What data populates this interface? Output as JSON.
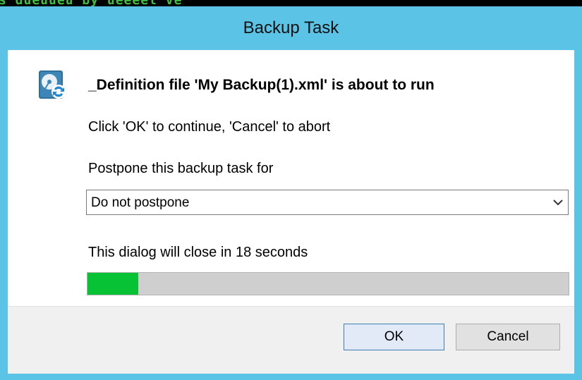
{
  "background_text": "s dueuueu by ueeeet ve",
  "window": {
    "title": "Backup Task"
  },
  "icon": "backup-drive-icon",
  "message": {
    "heading": "_Definition file 'My Backup(1).xml' is about to run",
    "instruction": "Click 'OK' to continue, 'Cancel' to abort"
  },
  "postpone": {
    "label": "Postpone this backup task for",
    "selected": "Do not postpone"
  },
  "countdown": {
    "text": "This dialog will close in 18 seconds",
    "progress_fraction": 0.105
  },
  "buttons": {
    "ok": "OK",
    "cancel": "Cancel"
  },
  "colors": {
    "title_bar": "#5bc4e6",
    "progress_fill": "#06c234",
    "progress_track": "#cfcfcf",
    "ok_border": "#3c7fb1"
  }
}
